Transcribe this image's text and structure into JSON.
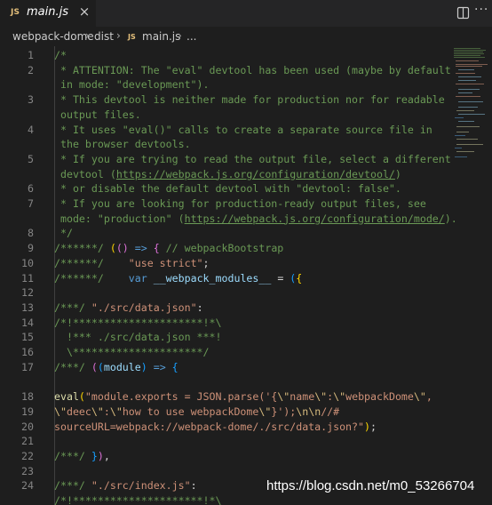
{
  "tab": {
    "badge": "JS",
    "title": "main.js",
    "close": "×"
  },
  "actions": {
    "more": "···"
  },
  "breadcrumb": {
    "items": [
      "webpack-dome",
      "dist",
      "main.js",
      "..."
    ],
    "separator": "›",
    "file_badge": "JS"
  },
  "watermark": "https://blog.csdn.net/m0_53266704",
  "editor": {
    "line_numbers": [
      "1",
      "2",
      "3",
      "4",
      "5",
      "6",
      "7",
      "8",
      "9",
      "10",
      "11",
      "12",
      "13",
      "14",
      "15",
      "16",
      "17",
      "18",
      "19",
      "20",
      "21",
      "22",
      "23",
      "24"
    ],
    "lines": [
      [
        {
          "t": "/*",
          "c": "c-com"
        }
      ],
      [
        {
          "t": " * ATTENTION: The \"eval\" devtool has been used (maybe by default",
          "c": "c-com"
        }
      ],
      [
        {
          "t": " in mode: \"development\").",
          "c": "c-com"
        }
      ],
      [
        {
          "t": " * This devtool is neither made for production nor for readable",
          "c": "c-com"
        }
      ],
      [
        {
          "t": " output files.",
          "c": "c-com"
        }
      ],
      [
        {
          "t": " * It uses \"eval()\" calls to create a separate source file in",
          "c": "c-com"
        }
      ],
      [
        {
          "t": " the browser devtools.",
          "c": "c-com"
        }
      ],
      [
        {
          "t": " * If you are trying to read the output file, select a different",
          "c": "c-com"
        }
      ],
      [
        {
          "t": " devtool (",
          "c": "c-com"
        },
        {
          "t": "https://webpack.js.org/configuration/devtool/",
          "c": "c-lnk"
        },
        {
          "t": ")",
          "c": "c-com"
        }
      ],
      [
        {
          "t": " * or disable the default devtool with \"devtool: false\".",
          "c": "c-com"
        }
      ],
      [
        {
          "t": " * If you are looking for production-ready output files, see",
          "c": "c-com"
        }
      ],
      [
        {
          "t": " mode: \"production\" (",
          "c": "c-com"
        },
        {
          "t": "https://webpack.js.org/configuration/mode/",
          "c": "c-lnk"
        },
        {
          "t": ").",
          "c": "c-com"
        }
      ],
      [
        {
          "t": " */",
          "c": "c-com"
        }
      ],
      [
        {
          "t": "/******/ ",
          "c": "c-com"
        },
        {
          "t": "(",
          "c": "c-br1"
        },
        {
          "t": "()",
          "c": "c-br2"
        },
        {
          "t": " => ",
          "c": "c-kw"
        },
        {
          "t": "{",
          "c": "c-br2"
        },
        {
          "t": " // webpackBootstrap",
          "c": "c-com"
        }
      ],
      [
        {
          "t": "/******/ ",
          "c": "c-com"
        },
        {
          "t": "   ",
          "c": "c-pun"
        },
        {
          "t": "\"use strict\"",
          "c": "c-str"
        },
        {
          "t": ";",
          "c": "c-pun"
        }
      ],
      [
        {
          "t": "/******/ ",
          "c": "c-com"
        },
        {
          "t": "   ",
          "c": "c-pun"
        },
        {
          "t": "var",
          "c": "c-kw"
        },
        {
          "t": " ",
          "c": "c-pun"
        },
        {
          "t": "__webpack_modules__",
          "c": "c-var"
        },
        {
          "t": " = ",
          "c": "c-pun"
        },
        {
          "t": "(",
          "c": "c-br3"
        },
        {
          "t": "{",
          "c": "c-br1"
        }
      ],
      [],
      [
        {
          "t": "/***/ ",
          "c": "c-com"
        },
        {
          "t": "\"./src/data.json\"",
          "c": "c-str"
        },
        {
          "t": ":",
          "c": "c-pun"
        }
      ],
      [
        {
          "t": "/*!*********************!*\\",
          "c": "c-com"
        }
      ],
      [
        {
          "t": "  !*** ./src/data.json ***!",
          "c": "c-com"
        }
      ],
      [
        {
          "t": "  \\*********************/",
          "c": "c-com"
        }
      ],
      [
        {
          "t": "/***/ ",
          "c": "c-com"
        },
        {
          "t": "(",
          "c": "c-br2"
        },
        {
          "t": "(",
          "c": "c-br3"
        },
        {
          "t": "module",
          "c": "c-var"
        },
        {
          "t": ")",
          "c": "c-br3"
        },
        {
          "t": " => ",
          "c": "c-kw"
        },
        {
          "t": "{",
          "c": "c-br3"
        }
      ],
      [],
      [
        {
          "t": "eval",
          "c": "c-fn"
        },
        {
          "t": "(",
          "c": "c-br1"
        },
        {
          "t": "\"module.exports = JSON.parse('{",
          "c": "c-str"
        },
        {
          "t": "\\\"",
          "c": "c-esc"
        },
        {
          "t": "name",
          "c": "c-str"
        },
        {
          "t": "\\\"",
          "c": "c-esc"
        },
        {
          "t": ":",
          "c": "c-str"
        },
        {
          "t": "\\\"",
          "c": "c-esc"
        },
        {
          "t": "webpackDome",
          "c": "c-str"
        },
        {
          "t": "\\\"",
          "c": "c-esc"
        },
        {
          "t": ",",
          "c": "c-str"
        }
      ],
      [
        {
          "t": "\\\"",
          "c": "c-esc"
        },
        {
          "t": "deec",
          "c": "c-str"
        },
        {
          "t": "\\\"",
          "c": "c-esc"
        },
        {
          "t": ":",
          "c": "c-str"
        },
        {
          "t": "\\\"",
          "c": "c-esc"
        },
        {
          "t": "how to use webpackDome",
          "c": "c-str"
        },
        {
          "t": "\\\"",
          "c": "c-esc"
        },
        {
          "t": "}');",
          "c": "c-str"
        },
        {
          "t": "\\n\\n",
          "c": "c-esc"
        },
        {
          "t": "//#",
          "c": "c-str"
        }
      ],
      [
        {
          "t": "sourceURL=webpack://webpack-dome/./src/data.json?\"",
          "c": "c-str"
        },
        {
          "t": ")",
          "c": "c-br1"
        },
        {
          "t": ";",
          "c": "c-pun"
        }
      ],
      [],
      [
        {
          "t": "/***/ ",
          "c": "c-com"
        },
        {
          "t": "}",
          "c": "c-br3"
        },
        {
          "t": ")",
          "c": "c-br2"
        },
        {
          "t": ",",
          "c": "c-pun"
        }
      ],
      [],
      [
        {
          "t": "/***/ ",
          "c": "c-com"
        },
        {
          "t": "\"./src/index.js\"",
          "c": "c-str"
        },
        {
          "t": ":",
          "c": "c-pun"
        }
      ],
      [
        {
          "t": "/*!*********************!*\\",
          "c": "c-com"
        }
      ]
    ]
  },
  "colors": {
    "editor_bg": "#1e1e1e",
    "tabbar_bg": "#252526",
    "comment": "#6a9955",
    "string": "#ce9178",
    "keyword": "#569cd6",
    "variable": "#9cdcfe",
    "function": "#dcdcaa",
    "line_number": "#858585"
  }
}
